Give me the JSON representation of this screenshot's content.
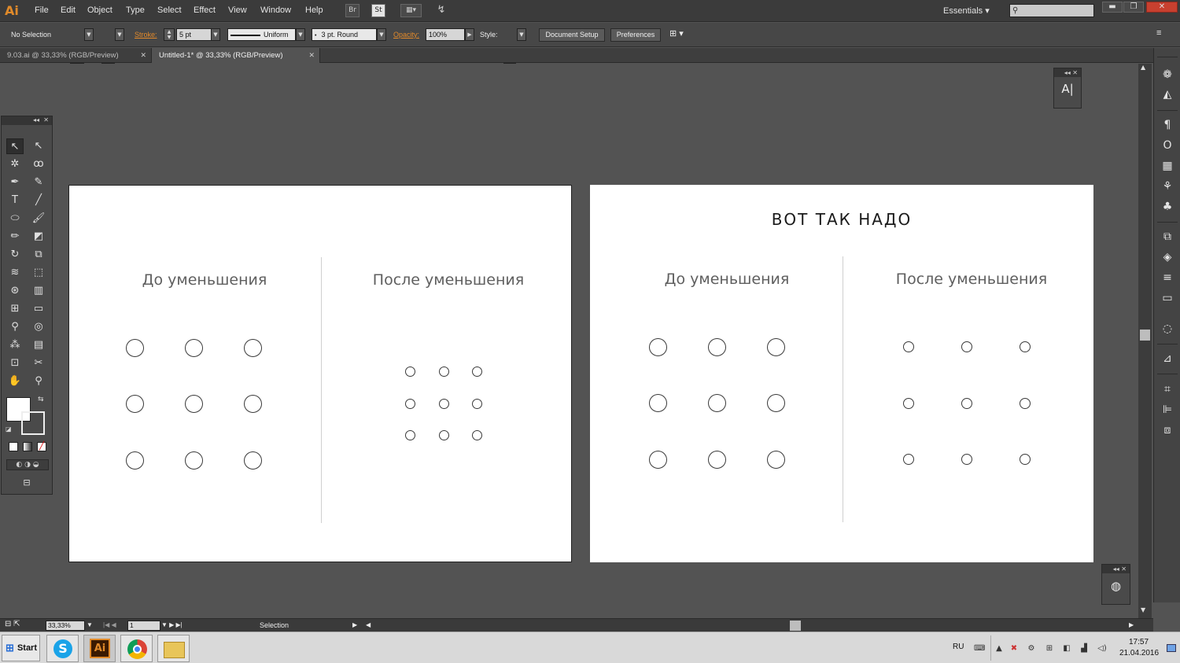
{
  "menubar": {
    "logo": "Ai",
    "items": [
      "File",
      "Edit",
      "Object",
      "Type",
      "Select",
      "Effect",
      "View",
      "Window",
      "Help"
    ],
    "bridge_label": "Br",
    "stock_label": "St",
    "workspace": "Essentials",
    "window_buttons": {
      "minimize": "▬",
      "restore": "❐",
      "close": "✕"
    }
  },
  "controlbar": {
    "selection_status": "No Selection",
    "stroke_label": "Stroke:",
    "stroke_value": "5 pt",
    "profile_value": "Uniform",
    "brush_value": "3 pt. Round",
    "opacity_label": "Opacity:",
    "opacity_value": "100%",
    "style_label": "Style:",
    "document_setup": "Document Setup",
    "preferences": "Preferences"
  },
  "tabs": [
    {
      "label": "9.03.ai @ 33,33% (RGB/Preview)",
      "active": false
    },
    {
      "label": "Untitled-1* @ 33,33% (RGB/Preview)",
      "active": true
    }
  ],
  "artboard1": {
    "left_heading": "До уменьшения",
    "right_heading": "После уменьшения"
  },
  "artboard2": {
    "title": "ВОТ ТАК НАДО",
    "left_heading": "До уменьшения",
    "right_heading": "После уменьшения"
  },
  "statusbar": {
    "zoom": "33,33%",
    "page": "1",
    "tool_name": "Selection"
  },
  "taskbar": {
    "start_label": "Start",
    "apps": [
      "skype",
      "illustrator",
      "chrome",
      "explorer"
    ],
    "illustrator_label": "Ai",
    "language": "RU",
    "time": "17:57",
    "date": "21.04.2016"
  },
  "colors": {
    "accent_orange": "#e38a2a",
    "canvas": "#535353",
    "artboard": "#ffffff"
  }
}
